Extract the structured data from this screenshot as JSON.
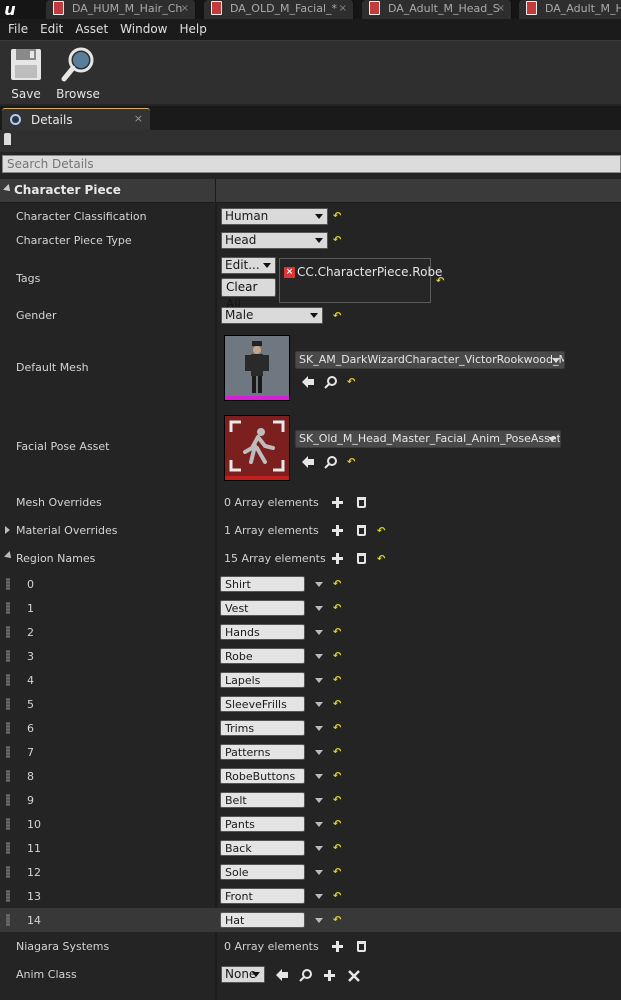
{
  "tabs": [
    {
      "label": "DA_HUM_M_Hair_Ch",
      "close": "×"
    },
    {
      "label": "DA_OLD_M_Facial_*",
      "close": "×"
    },
    {
      "label": "DA_Adult_M_Head_S",
      "close": "×"
    },
    {
      "label": "DA_Adult_M_H",
      "close": ""
    }
  ],
  "logo": "u",
  "menu": [
    "File",
    "Edit",
    "Asset",
    "Window",
    "Help"
  ],
  "toolbar": {
    "save_label": "Save",
    "browse_label": "Browse"
  },
  "panel": {
    "title": "Details",
    "close": "×"
  },
  "search": {
    "placeholder": "Search Details"
  },
  "category": {
    "title": "Character Piece"
  },
  "props": {
    "classification": {
      "label": "Character Classification",
      "value": "Human"
    },
    "piece_type": {
      "label": "Character Piece Type",
      "value": "Head"
    },
    "tags": {
      "label": "Tags",
      "edit_label": "Edit...",
      "clear_label": "Clear All",
      "tag_value": "CC.CharacterPiece.Robe"
    },
    "gender": {
      "label": "Gender",
      "value": "Male"
    },
    "default_mesh": {
      "label": "Default Mesh",
      "value": "SK_AM_DarkWizardCharacter_VictorRookwood_Ma"
    },
    "facial_pose": {
      "label": "Facial Pose Asset",
      "value": "SK_Old_M_Head_Master_Facial_Anim_PoseAsset"
    },
    "mesh_overrides": {
      "label": "Mesh Overrides",
      "count": "0 Array elements"
    },
    "material_overrides": {
      "label": "Material Overrides",
      "count": "1 Array elements"
    },
    "region_names": {
      "label": "Region Names",
      "count": "15 Array elements"
    },
    "niagara": {
      "label": "Niagara Systems",
      "count": "0 Array elements"
    },
    "anim_class": {
      "label": "Anim Class",
      "value": "None"
    }
  },
  "regions": [
    {
      "index": "0",
      "value": "Shirt"
    },
    {
      "index": "1",
      "value": "Vest"
    },
    {
      "index": "2",
      "value": "Hands"
    },
    {
      "index": "3",
      "value": "Robe"
    },
    {
      "index": "4",
      "value": "Lapels"
    },
    {
      "index": "5",
      "value": "SleeveFrills"
    },
    {
      "index": "6",
      "value": "Trims"
    },
    {
      "index": "7",
      "value": "Patterns"
    },
    {
      "index": "8",
      "value": "RobeButtons"
    },
    {
      "index": "9",
      "value": "Belt"
    },
    {
      "index": "10",
      "value": "Pants"
    },
    {
      "index": "11",
      "value": "Back"
    },
    {
      "index": "12",
      "value": "Sole"
    },
    {
      "index": "13",
      "value": "Front"
    },
    {
      "index": "14",
      "value": "Hat"
    }
  ],
  "colors": {
    "accent_tab": "#d9b36b",
    "reset_arrow": "#e2d22e",
    "mesh_bar": "#d61fd6",
    "pose_bar": "#c41f1f"
  },
  "icons": {
    "reset": "reset-to-default-icon",
    "use": "use-selected-icon",
    "find": "browse-asset-icon"
  }
}
